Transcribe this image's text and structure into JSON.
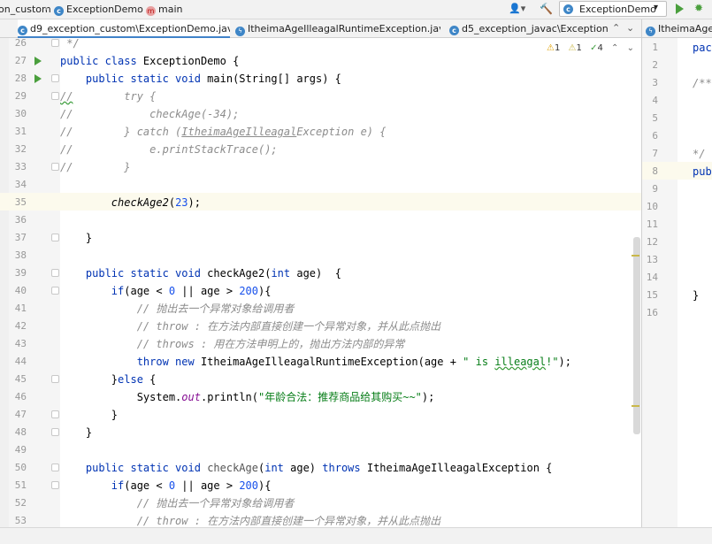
{
  "nav": {
    "crumb1": "on_custom",
    "crumb2": "ExceptionDemo",
    "crumb3": "main",
    "run_config": "ExceptionDemo"
  },
  "tabs": [
    "d9_exception_custom\\ExceptionDemo.java",
    "ItheimaAgeIlleagalRuntimeException.java",
    "d5_exception_javac\\ExceptionDemo",
    "ItheimaAgeIl"
  ],
  "inspection": {
    "warn1": "1",
    "warn2": "1",
    "ok": "4"
  },
  "editor": {
    "line_numbers": [
      "26",
      "27",
      "28",
      "29",
      "30",
      "31",
      "32",
      "33",
      "34",
      "35",
      "36",
      "37",
      "38",
      "39",
      "40",
      "41",
      "42",
      "43",
      "44",
      "45",
      "46",
      "47",
      "48",
      "49",
      "50",
      "51",
      "52",
      "53"
    ]
  },
  "editor2": {
    "line_numbers": [
      "1",
      "2",
      "3",
      "4",
      "5",
      "6",
      "7",
      "8",
      "9",
      "10",
      "11",
      "12",
      "13",
      "14",
      "15",
      "16"
    ],
    "lines": [
      "pacl",
      "",
      "/**",
      "",
      "",
      "",
      "*/",
      "publ",
      "",
      "",
      "",
      "",
      "",
      "",
      "}",
      ""
    ]
  }
}
